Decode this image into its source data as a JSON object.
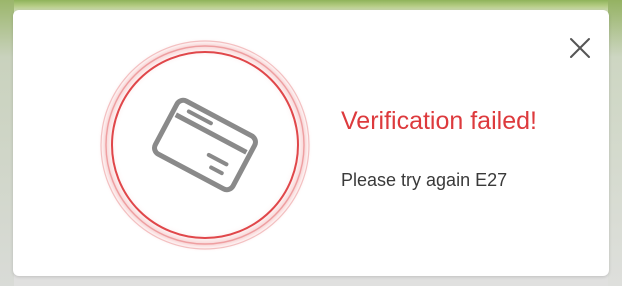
{
  "dialog": {
    "title": "Verification failed!",
    "message": "Please try again E27",
    "close_icon": "close-icon",
    "status_icon": "credit-card-icon",
    "accent_color": "#dd3a3d"
  }
}
